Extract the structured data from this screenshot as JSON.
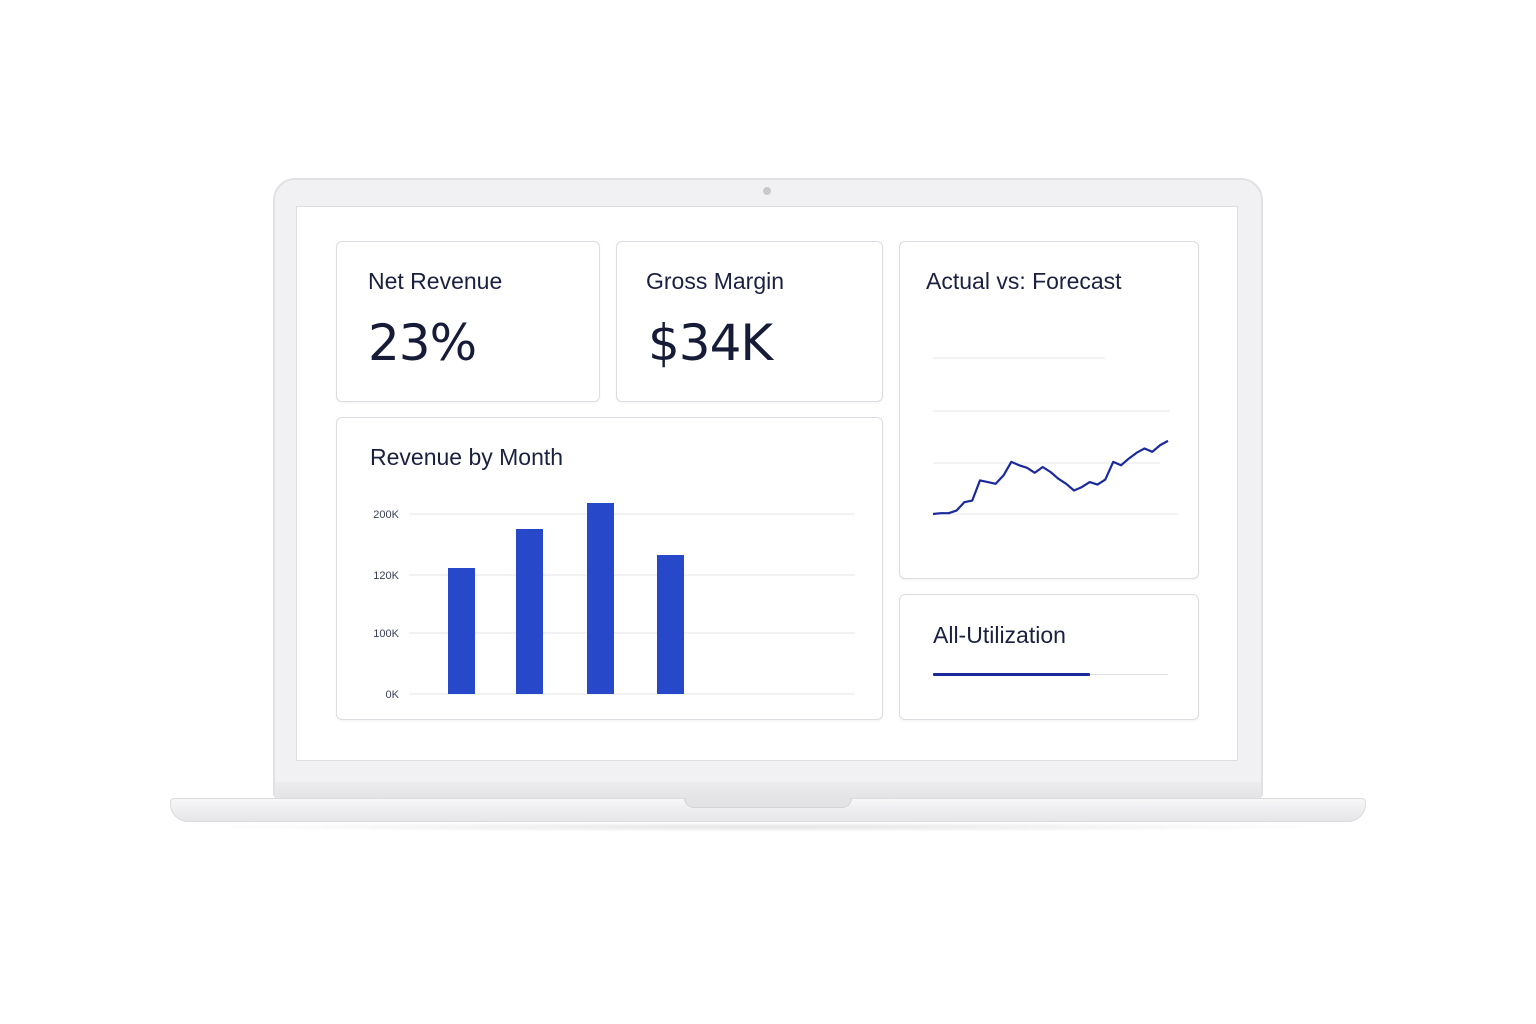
{
  "dashboard": {
    "net_revenue": {
      "label": "Net Revenue",
      "value": "23%"
    },
    "gross_margin": {
      "label": "Gross Margin",
      "value": "$34K"
    },
    "actual_vs_forecast": {
      "title": "Actual vs: Forecast"
    },
    "revenue_by_month": {
      "title": "Revenue by Month"
    },
    "utilization": {
      "title": "All-Utilization",
      "progress_fraction": 0.67
    }
  },
  "colors": {
    "accent_bar": "#2748c9",
    "accent_line": "#1a2a9c",
    "text_dark": "#161c38"
  },
  "chart_data": [
    {
      "type": "bar",
      "title": "Revenue by Month",
      "y_tick_labels": [
        "200K",
        "120K",
        "100K",
        "0K"
      ],
      "categories": [
        "",
        "",
        "",
        ""
      ],
      "values": [
        126,
        165,
        191,
        139
      ],
      "value_scale_note": "",
      "grid": true
    },
    {
      "type": "line",
      "title": "Actual vs: Forecast",
      "y": [
        0.0,
        0.01,
        0.01,
        0.04,
        0.14,
        0.16,
        0.4,
        0.38,
        0.36,
        0.46,
        0.62,
        0.58,
        0.55,
        0.49,
        0.56,
        0.5,
        0.42,
        0.36,
        0.28,
        0.32,
        0.38,
        0.35,
        0.41,
        0.62,
        0.58,
        0.66,
        0.73,
        0.78,
        0.74,
        0.82,
        0.87
      ],
      "grid": true,
      "ylim": [
        0,
        1
      ]
    }
  ]
}
